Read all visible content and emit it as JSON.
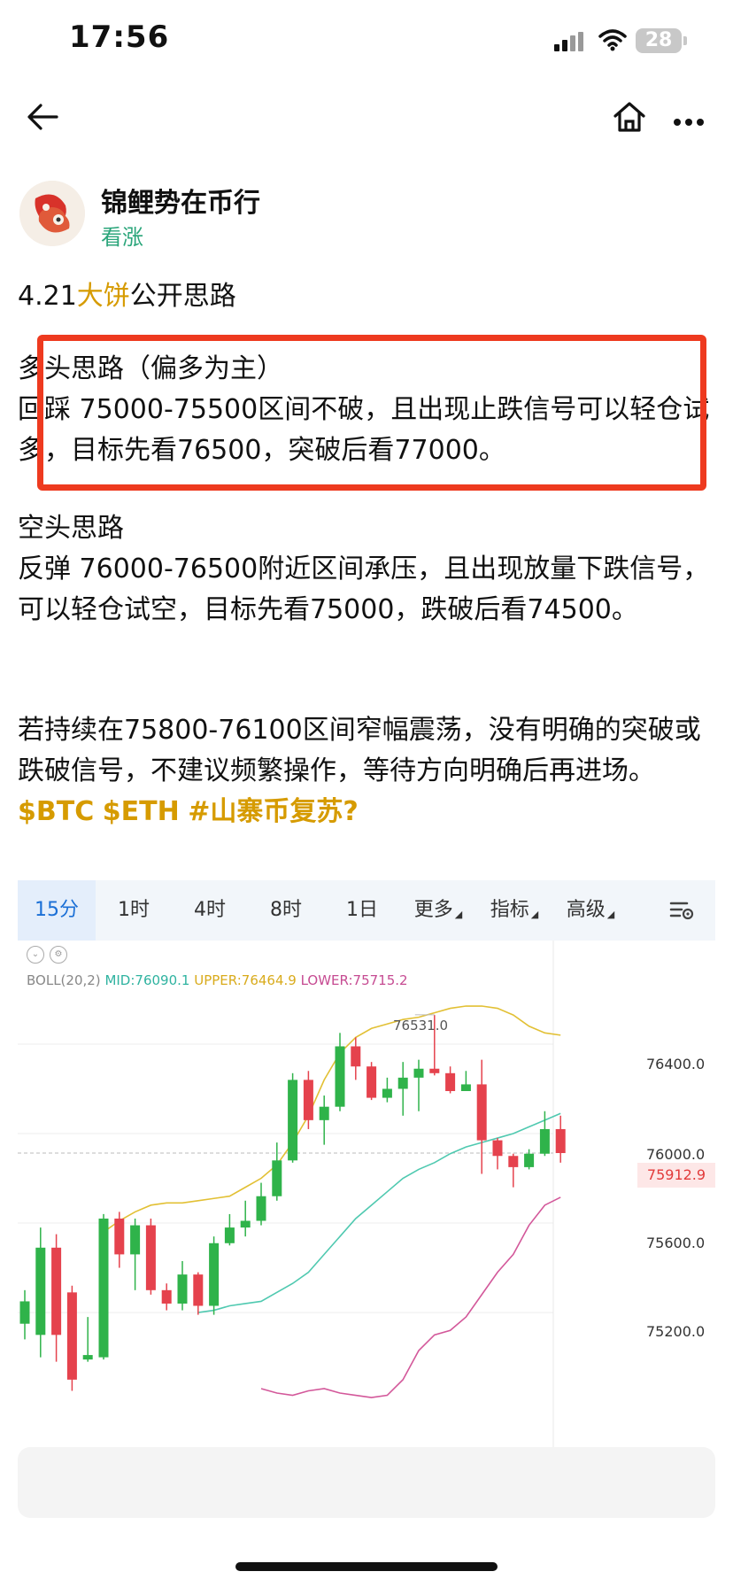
{
  "status_bar": {
    "time": "17:56",
    "battery": "28"
  },
  "nav": {
    "back_icon": "arrow-left-icon",
    "home_icon": "home-icon",
    "more_icon": "more-dots-icon"
  },
  "author": {
    "name": "锦鲤势在币行",
    "tag": "看涨"
  },
  "post": {
    "title_prefix": "4.21",
    "title_highlight": "大饼",
    "title_suffix": "公开思路",
    "long_heading": "多头思路（偏多为主）",
    "long_body": "回踩 75000-75500区间不破，且出现止跌信号可以轻仓试多，目标先看76500，突破后看77000。",
    "short_heading": "空头思路",
    "short_body": "反弹 76000-76500附近区间承压，且出现放量下跌信号，可以轻仓试空，目标先看75000，跌破后看74500。",
    "range_body": "若持续在75800-76100区间窄幅震荡，没有明确的突破或跌破信号，不建议频繁操作，等待方向明确后再进场。",
    "tags": [
      "$BTC",
      "$ETH",
      "#山寨币复苏?"
    ]
  },
  "chart": {
    "tabs": [
      "15分",
      "1时",
      "4时",
      "8时",
      "1日",
      "更多",
      "指标",
      "高级"
    ],
    "tab_carets": [
      "更多",
      "指标",
      "高级"
    ],
    "active_tab": "15分",
    "boll_label": "BOLL(20,2)",
    "mid_label": "MID:76090.1",
    "upper_label": "UPPER:76464.9",
    "lower_label": "LOWER:75715.2",
    "peak_label": "76531.0",
    "y_labels": [
      "76400.0",
      "76000.0",
      "75600.0",
      "75200.0"
    ],
    "current_price": "75912.9",
    "colors": {
      "up": "#2fb34a",
      "down": "#e5424d",
      "mid": "#4fc9b0",
      "upper": "#e2c034",
      "lower": "#d3589a"
    }
  },
  "chart_data": {
    "type": "candlestick",
    "title": "",
    "y_ticks": [
      76400,
      76000,
      75600,
      75200
    ],
    "current_price": 75912.9,
    "peak_label_value": 76531.0,
    "indicator": {
      "name": "BOLL(20,2)",
      "mid_last": 76090.1,
      "upper_last": 76464.9,
      "lower_last": 75715.2
    },
    "candles": [
      {
        "o": 75150,
        "c": 75250,
        "h": 75300,
        "l": 75080
      },
      {
        "o": 75100,
        "c": 75490,
        "h": 75580,
        "l": 75000
      },
      {
        "o": 75490,
        "c": 75100,
        "h": 75550,
        "l": 74980
      },
      {
        "o": 75290,
        "c": 74900,
        "h": 75320,
        "l": 74850
      },
      {
        "o": 74990,
        "c": 75010,
        "h": 75180,
        "l": 74980
      },
      {
        "o": 75000,
        "c": 75620,
        "h": 75640,
        "l": 74990
      },
      {
        "o": 75620,
        "c": 75460,
        "h": 75650,
        "l": 75400
      },
      {
        "o": 75460,
        "c": 75590,
        "h": 75620,
        "l": 75300
      },
      {
        "o": 75590,
        "c": 75300,
        "h": 75620,
        "l": 75280
      },
      {
        "o": 75300,
        "c": 75240,
        "h": 75330,
        "l": 75210
      },
      {
        "o": 75240,
        "c": 75370,
        "h": 75430,
        "l": 75210
      },
      {
        "o": 75370,
        "c": 75230,
        "h": 75380,
        "l": 75190
      },
      {
        "o": 75230,
        "c": 75510,
        "h": 75540,
        "l": 75190
      },
      {
        "o": 75510,
        "c": 75580,
        "h": 75640,
        "l": 75500
      },
      {
        "o": 75580,
        "c": 75610,
        "h": 75700,
        "l": 75540
      },
      {
        "o": 75610,
        "c": 75720,
        "h": 75780,
        "l": 75590
      },
      {
        "o": 75720,
        "c": 75880,
        "h": 75960,
        "l": 75700
      },
      {
        "o": 75880,
        "c": 76240,
        "h": 76270,
        "l": 75870
      },
      {
        "o": 76240,
        "c": 76060,
        "h": 76280,
        "l": 76020
      },
      {
        "o": 76060,
        "c": 76120,
        "h": 76170,
        "l": 75950
      },
      {
        "o": 76120,
        "c": 76390,
        "h": 76450,
        "l": 76100
      },
      {
        "o": 76390,
        "c": 76300,
        "h": 76430,
        "l": 76240
      },
      {
        "o": 76300,
        "c": 76160,
        "h": 76320,
        "l": 76150
      },
      {
        "o": 76160,
        "c": 76200,
        "h": 76250,
        "l": 76140
      },
      {
        "o": 76200,
        "c": 76250,
        "h": 76320,
        "l": 76080
      },
      {
        "o": 76250,
        "c": 76290,
        "h": 76330,
        "l": 76100
      },
      {
        "o": 76290,
        "c": 76270,
        "h": 76530,
        "l": 76260
      },
      {
        "o": 76270,
        "c": 76190,
        "h": 76300,
        "l": 76180
      },
      {
        "o": 76190,
        "c": 76220,
        "h": 76280,
        "l": 76190
      },
      {
        "o": 76220,
        "c": 75970,
        "h": 76330,
        "l": 75820
      },
      {
        "o": 75970,
        "c": 75900,
        "h": 75980,
        "l": 75840
      },
      {
        "o": 75900,
        "c": 75850,
        "h": 75910,
        "l": 75760
      },
      {
        "o": 75850,
        "c": 75910,
        "h": 75930,
        "l": 75840
      },
      {
        "o": 75910,
        "c": 76020,
        "h": 76100,
        "l": 75900
      },
      {
        "o": 76020,
        "c": 75912.9,
        "h": 76080,
        "l": 75870
      }
    ],
    "bands": {
      "upper": [
        75560,
        75610,
        75650,
        75680,
        75690,
        75690,
        75700,
        75710,
        75720,
        75760,
        75800,
        75860,
        75960,
        76080,
        76240,
        76360,
        76430,
        76470,
        76490,
        76510,
        76520,
        76540,
        76560,
        76570,
        76570,
        76560,
        76530,
        76480,
        76450,
        76440
      ],
      "mid": [
        75200,
        75210,
        75230,
        75240,
        75250,
        75290,
        75330,
        75380,
        75460,
        75540,
        75620,
        75680,
        75740,
        75800,
        75840,
        75870,
        75910,
        75940,
        75960,
        75980,
        76000,
        76030,
        76060,
        76090
      ],
      "lower": [
        74860,
        74840,
        74830,
        74850,
        74860,
        74840,
        74830,
        74820,
        74830,
        74900,
        75030,
        75100,
        75120,
        75180,
        75280,
        75380,
        75460,
        75590,
        75680,
        75715.2
      ]
    }
  }
}
